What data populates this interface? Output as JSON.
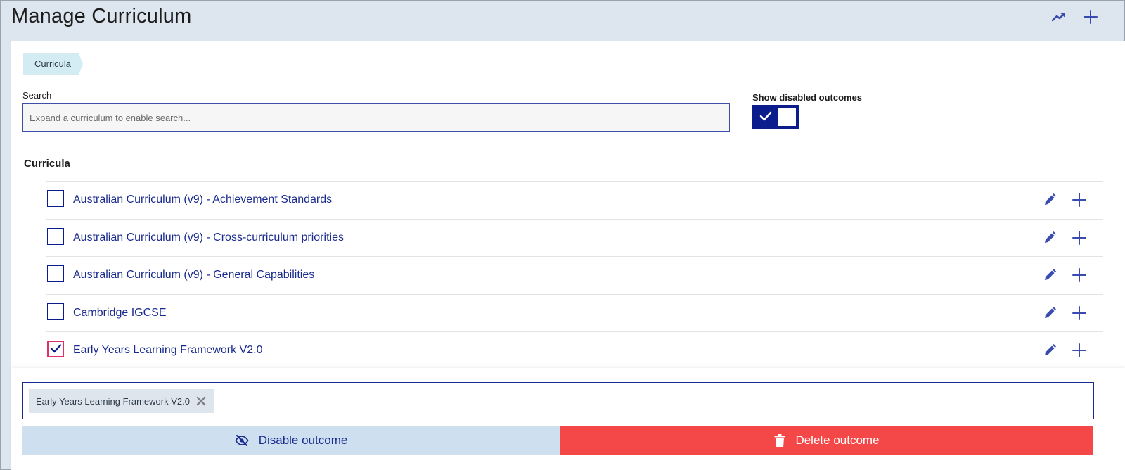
{
  "header": {
    "title": "Manage Curriculum",
    "icons": [
      "trending-up-icon",
      "plus-icon"
    ]
  },
  "breadcrumb": [
    "Curricula"
  ],
  "search": {
    "label": "Search",
    "placeholder": "Expand a curriculum to enable search...",
    "value": ""
  },
  "toggle": {
    "label": "Show disabled outcomes",
    "checked": true
  },
  "section": {
    "heading": "Curricula"
  },
  "curricula": [
    {
      "label": "Australian Curriculum (v9) - Achievement Standards",
      "checked": false
    },
    {
      "label": "Australian Curriculum (v9) - Cross-curriculum priorities",
      "checked": false
    },
    {
      "label": "Australian Curriculum (v9) - General Capabilities",
      "checked": false
    },
    {
      "label": "Cambridge IGCSE",
      "checked": false
    },
    {
      "label": "Early Years Learning Framework V2.0",
      "checked": true
    }
  ],
  "selection": {
    "chips": [
      "Early Years Learning Framework V2.0"
    ]
  },
  "actions": {
    "disable_label": "Disable outcome",
    "delete_label": "Delete outcome"
  },
  "colors": {
    "accent": "#0b1d8c",
    "link": "#1a2b8f",
    "danger": "#f44848",
    "header_bg": "#dde5ee",
    "checkbox_focus": "#e0306a"
  }
}
